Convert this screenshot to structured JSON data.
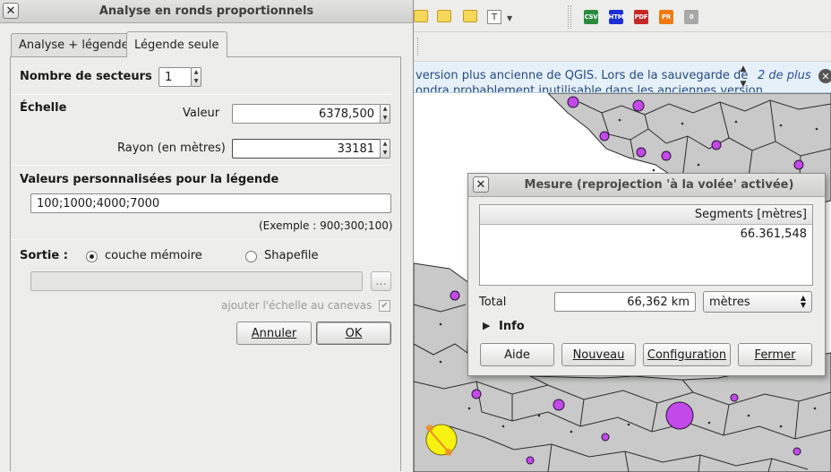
{
  "dialog_left": {
    "title": "Analyse en ronds proportionnels",
    "tabs": [
      "Analyse + légende",
      "Légende seule"
    ],
    "sectors_label": "Nombre de secteurs",
    "sectors_value": "1",
    "scale_heading": "Échelle",
    "value_label": "Valeur",
    "value_value": "6378,500",
    "radius_label": "Rayon (en mètres)",
    "radius_value": "33181",
    "custom_heading": "Valeurs personnalisées pour la légende",
    "custom_value": "100;1000;4000;7000",
    "example_text": "(Exemple : 900;300;100)",
    "output_label": "Sortie :",
    "opt_memory": "couche mémoire",
    "opt_shapefile": "Shapefile",
    "path_value": "",
    "browse_label": "...",
    "add_scale_label": "ajouter l'échelle au canevas",
    "add_scale_checked": true,
    "cancel_label": "Annuler",
    "ok_label": "OK"
  },
  "dialog_measure": {
    "title": "Mesure (reprojection 'à la volée' activée)",
    "column_header": "Segments [mètres]",
    "segments": [
      "66.361,548"
    ],
    "total_label": "Total",
    "total_value": "66,362 km",
    "unit_value": "mètres",
    "info_label": "Info",
    "help_label": "Aide",
    "new_label": "Nouveau",
    "config_label": "Configuration",
    "close_label": "Fermer"
  },
  "background": {
    "toolbar_labels": [
      "CSV",
      "HTM",
      "PDF",
      "PR",
      "0"
    ],
    "toolbar_colors": [
      "#2b8a3e",
      "#1c2fd6",
      "#c62828",
      "#f07a12",
      "#a8a8a8"
    ],
    "message_line1": "version plus ancienne de QGIS. Lors de la sauvegarde de",
    "message_line2": "ondra probablement inutilisable dans les anciennes version",
    "more_label": "2 de plus"
  }
}
